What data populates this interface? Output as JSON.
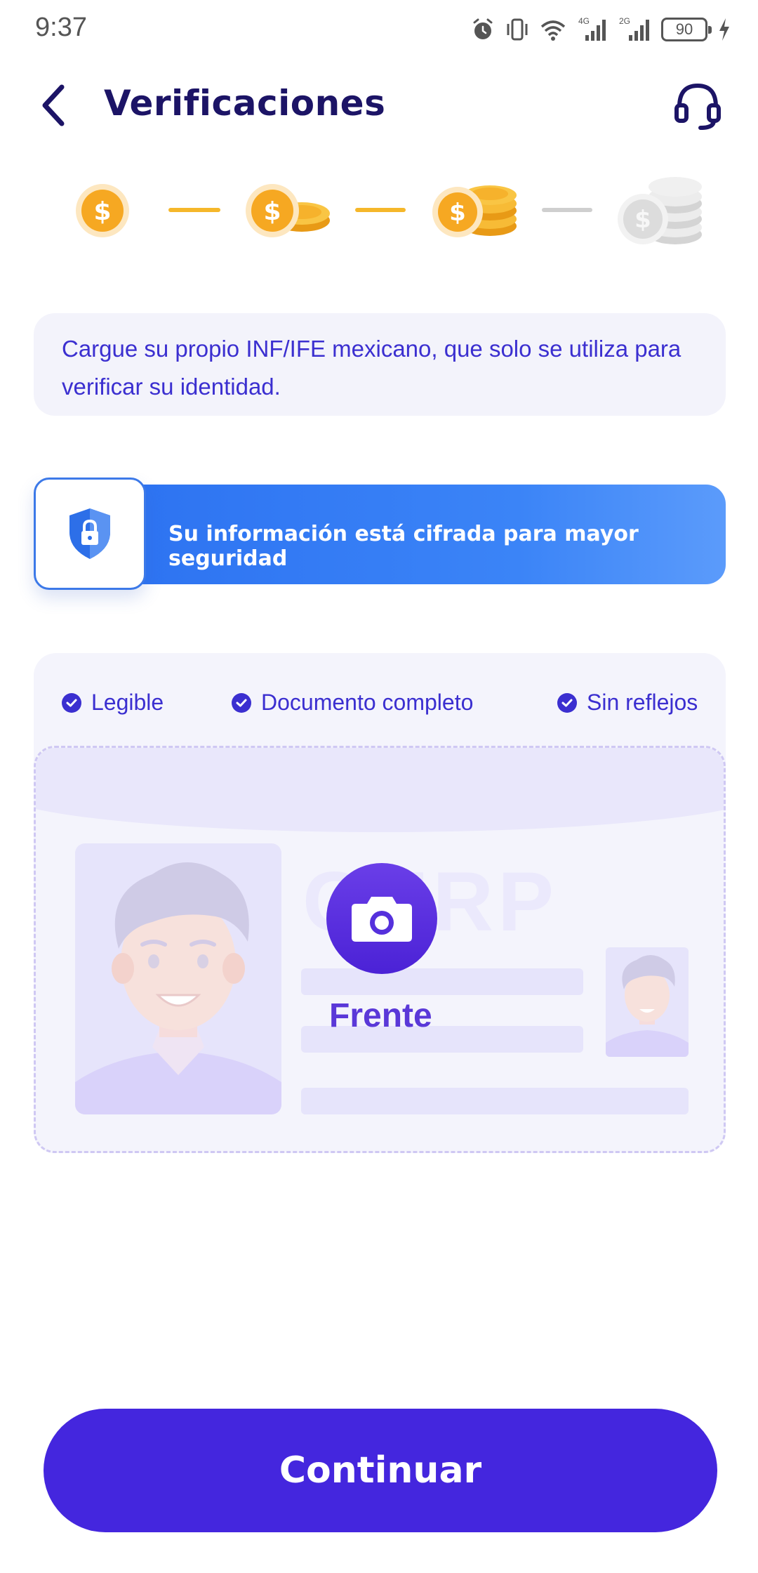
{
  "status_bar": {
    "time": "9:37",
    "battery": "90",
    "icons": [
      "alarm-icon",
      "vibrate-icon",
      "wifi-icon",
      "signal-4g-icon",
      "signal-2g-icon",
      "battery-icon",
      "charging-icon"
    ],
    "network_labels": [
      "4G",
      "2G"
    ]
  },
  "header": {
    "title": "Verificaciones",
    "back_icon": "chevron-left-icon",
    "support_icon": "headset-icon"
  },
  "stepper": {
    "steps": [
      {
        "icon": "coin-single-icon",
        "state": "complete"
      },
      {
        "icon": "coin-double-icon",
        "state": "complete"
      },
      {
        "icon": "coin-stack-icon",
        "state": "active"
      },
      {
        "icon": "coin-stack-large-icon",
        "state": "pending"
      }
    ]
  },
  "info": {
    "text": "Cargue su propio INF/IFE mexicano, que solo se utiliza para verificar su identidad."
  },
  "security": {
    "text": "Su información está cifrada para mayor seguridad",
    "icon": "shield-lock-icon"
  },
  "upload": {
    "checks": [
      "Legible",
      "Documento completo",
      "Sin reflejos"
    ],
    "watermark": "CURP",
    "side_label": "Frente",
    "camera_icon": "camera-icon"
  },
  "actions": {
    "continue_label": "Continuar"
  },
  "colors": {
    "primary": "#4426de",
    "title": "#1c1466",
    "accent_text": "#3b2fd0",
    "banner_blue": "#2a6ff0",
    "coin_gold": "#f5b02c",
    "step_gray": "#cfcfcf"
  }
}
